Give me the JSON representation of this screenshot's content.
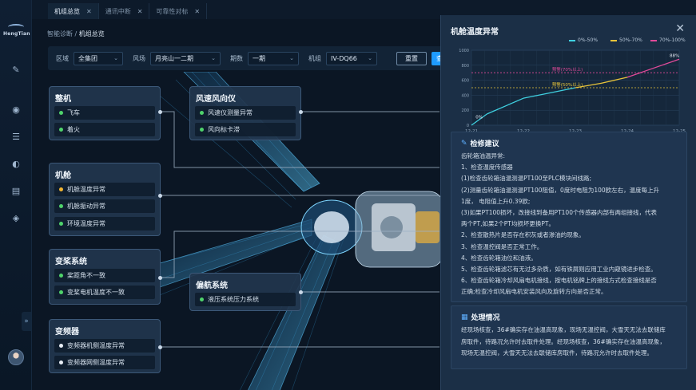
{
  "tabs": [
    {
      "label": "机组总览",
      "active": true
    },
    {
      "label": "通讯中断",
      "active": false
    },
    {
      "label": "可靠性对标",
      "active": false
    }
  ],
  "logo": "HengTian",
  "breadcrumb": {
    "parent": "智能诊断 /",
    "current": "机组总览"
  },
  "filter": {
    "area_label": "区域",
    "area_value": "全集团",
    "farm_label": "风场",
    "farm_value": "月亮山一二期",
    "phase_label": "期数",
    "phase_value": "一期",
    "unit_label": "机组",
    "unit_value": "IV-DQ66",
    "reset_label": "重置",
    "query_label": "查询"
  },
  "groups": {
    "zhengji": {
      "title": "整机",
      "items": [
        "飞车",
        "着火"
      ]
    },
    "fengsu": {
      "title": "风速风向仪",
      "items": [
        "风速仪测量异常",
        "风向标卡滞"
      ]
    },
    "jicang": {
      "title": "机舱",
      "items": [
        "机舱温度异常",
        "机舱振动异常",
        "环境温度异常"
      ]
    },
    "bianjiang": {
      "title": "变桨系统",
      "items": [
        "桨距角不一致",
        "变桨电机温度不一致"
      ]
    },
    "pianhang": {
      "title": "偏航系统",
      "items": [
        "液压系统压力系统"
      ]
    },
    "bianpinqi": {
      "title": "变频器",
      "items": [
        "变频器机侧温度异常",
        "变频器网侧温度异常"
      ]
    }
  },
  "colors": {
    "ok": "#4fd36b",
    "warn": "#f2b531",
    "off": "#e8eef5",
    "accent": "#1e9bff",
    "cyan": "#3fd0e0",
    "yellow": "#e8c43a",
    "pink": "#e24a9a"
  },
  "panel": {
    "title": "机舱温度异常",
    "legend": [
      "0%-50%",
      "50%-70%",
      "70%-100%"
    ],
    "repair_title": "检修建议",
    "repair_lines": [
      "齿轮箱油温异常:",
      "1、检查温度传感器",
      "(1)检查齿轮箱油温测温PT100至PLC模块间线路;",
      "(2)测量齿轮箱油温测温PT100阻值，0度时电阻为100欧左右，温度每上升",
      "1度， 电阻值上升0.39欧;",
      "(3)如果PT100损坏，改接线到备用PT100个传感器内部有两组接线，代表",
      "两个PT,如果2个PT均损坏更换PT。",
      "2、检查散热片是否存在积灰或者渗油的现象。",
      "3、检查温控阀是否正常工作。",
      "4、检查齿轮箱油位和油液。",
      "5、检查齿轮箱滤芯有无过多杂质，如有铁屑则应用工业内窥镜进步检查。",
      "6、检查齿轮箱冷却风扇电机接线，按电机铭牌上的接线方式检查接线是否",
      "正确;检查冷却风扇电机安装风向及旋转方向是否正常。"
    ],
    "handle_title": "处理情况",
    "handle_lines": [
      "经现场核查，36#确实存在油温高现象，现场无温控阀，大雪天无法去联储库",
      "房取件，待路况允许时去取件处理。经现场核查，36#确实存在油温高现象，",
      "现场无温控阀，大雪天无法去联储库房取件，待路况允许时去取件处理。"
    ]
  },
  "chart_data": {
    "type": "line",
    "x": [
      "12-21",
      "12-22",
      "12-23",
      "12-24",
      "12-25"
    ],
    "ylim": [
      0,
      1000
    ],
    "yticks": [
      "0",
      "200",
      "400",
      "600",
      "800",
      "1000"
    ],
    "series": [
      {
        "points": [
          [
            0,
            0
          ],
          [
            0.3,
            150
          ],
          [
            1,
            360
          ],
          [
            1.5,
            430
          ],
          [
            2,
            500
          ],
          [
            2.5,
            560
          ],
          [
            3,
            640
          ],
          [
            3.5,
            760
          ],
          [
            4,
            880
          ]
        ]
      }
    ],
    "thresholds": [
      {
        "label": "预警(70%以上)",
        "value": 700,
        "color": "#e24a9a"
      },
      {
        "label": "预警(50%以上)",
        "value": 500,
        "color": "#e8c43a"
      }
    ],
    "annotations": [
      {
        "label": "0%",
        "x": 0.05,
        "y": 60
      },
      {
        "label": "88%",
        "x": 4,
        "y": 880
      }
    ]
  }
}
